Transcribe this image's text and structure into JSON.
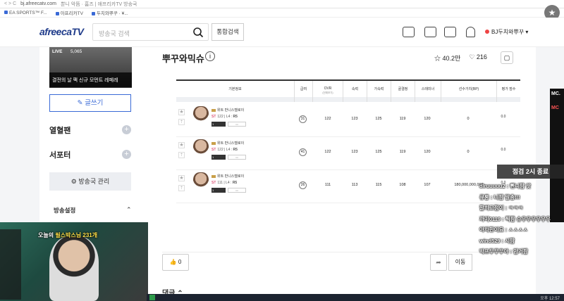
{
  "browser": {
    "url": "bj.afreecatv.com",
    "title": "뿐니 악뜸 · 홈즈 | 애프리카TV 방송국"
  },
  "bookmarks": [
    "EA SPORTS™ F...",
    "아프리카TV",
    "두치와뿌꾸 · ¥..."
  ],
  "header": {
    "logo": "afreecaTV",
    "search_placeholder": "방송국 검색",
    "integrated_search": "통합검색",
    "user_name": "BJ두치와뿌꾸"
  },
  "sidebar": {
    "live_badge": "LIVE",
    "viewer_count": "5,065",
    "thumb_caption": "결전의 날 팩 신규 모먼트 레페레",
    "write_button": "글쓰기",
    "fan_menu": "열혈팬",
    "supporter_menu": "서포터",
    "station_manage": "방송국 관리",
    "settings": "방송설정"
  },
  "board": {
    "title": "뿌꾸와믹슈",
    "favorites": "40.2만",
    "followers": "216"
  },
  "table": {
    "headers": [
      {
        "label": "기본정보",
        "sub": ""
      },
      {
        "label": "급여",
        "sub": ""
      },
      {
        "label": "OVR",
        "sub": "(전체보기)"
      },
      {
        "label": "속력",
        "sub": ""
      },
      {
        "label": "가속력",
        "sub": ""
      },
      {
        "label": "골결정",
        "sub": ""
      },
      {
        "label": "스태미너",
        "sub": ""
      },
      {
        "label": "선수가치(BP)",
        "sub": ""
      },
      {
        "label": "평가 점수",
        "sub": ""
      }
    ],
    "rows": [
      {
        "name": "위트 반니스텔로이",
        "pos": "ST",
        "ovr_tag": "122",
        "lvl": "L4",
        "side": "R5",
        "grade": "1",
        "salary": "31",
        "ovr": "122",
        "speed": "123",
        "accel": "125",
        "finish": "119",
        "stamina": "120",
        "value": "0",
        "score": "0.0"
      },
      {
        "name": "위트 반니스텔로이",
        "pos": "ST",
        "ovr_tag": "122",
        "lvl": "L4",
        "side": "R5",
        "grade": "1",
        "salary": "41",
        "ovr": "122",
        "speed": "123",
        "accel": "125",
        "finish": "119",
        "stamina": "120",
        "value": "0",
        "score": "0.0"
      },
      {
        "name": "위트 반니스텔로이",
        "pos": "ST",
        "ovr_tag": "111",
        "lvl": "L4",
        "side": "R5",
        "grade": "1",
        "salary": "26",
        "ovr": "111",
        "speed": "113",
        "accel": "115",
        "finish": "108",
        "stamina": "107",
        "value": "180,000,000,000",
        "score": "0.0"
      }
    ]
  },
  "footer": {
    "likes": "0",
    "move": "이동",
    "comments": "댓글"
  },
  "stream": {
    "caption_prefix": "오늘의",
    "caption_highlight": "필스박스님",
    "caption_count": "231개",
    "end_banner": "점검 2시 종료",
    "side_text1": "MC.",
    "side_text2": "MC",
    "chat": [
      "dlruuuuu2 : 빤니팜 팟",
      "큐롱 : 니팜 말충!!!",
      "깔히고점이 : ㅋㅋㅋ",
      "까미0119 : 찍팜 슈우우우우우우",
      "야차한이요 : ㅅㅅㅅㅅ",
      "wind529 : 시팜",
      "박프두무우아 : 암거팜"
    ],
    "clock": "오후 12:57"
  }
}
